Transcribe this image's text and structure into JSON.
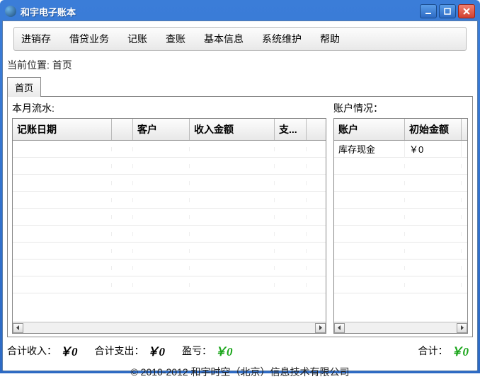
{
  "window": {
    "title": "和宇电子账本"
  },
  "menu": {
    "items": [
      "进销存",
      "借贷业务",
      "记账",
      "查账",
      "基本信息",
      "系统维护",
      "帮助"
    ]
  },
  "breadcrumb": {
    "label": "当前位置:",
    "value": "首页"
  },
  "tabs": [
    {
      "label": "首页"
    }
  ],
  "left_panel": {
    "title": "本月流水:",
    "columns": [
      "记账日期",
      "",
      "客户",
      "收入金额",
      "支..."
    ],
    "rows": []
  },
  "right_panel": {
    "title": "账户情况：",
    "columns": [
      "账户",
      "初始金额"
    ],
    "rows": [
      {
        "account": "库存现金",
        "initial": "￥0"
      }
    ]
  },
  "totals": {
    "income_label": "合计收入：",
    "income_value": "￥0",
    "expense_label": "合计支出：",
    "expense_value": "￥0",
    "profit_label": "盈亏：",
    "profit_value": "￥0",
    "sum_label": "合计：",
    "sum_value": "￥0"
  },
  "footer": {
    "text": "© 2010-2012  和宇时空（北京）信息技术有限公司"
  }
}
